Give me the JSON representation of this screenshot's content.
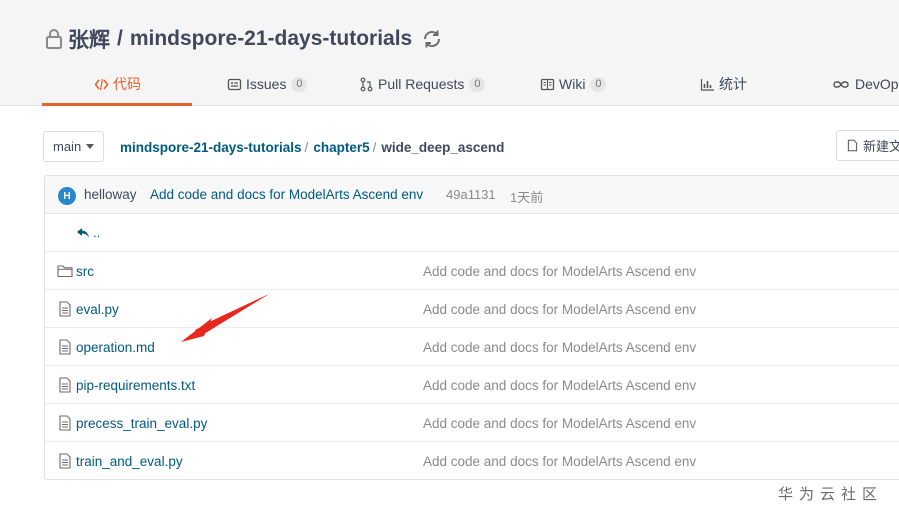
{
  "repo": {
    "owner": "张辉",
    "separator": "/",
    "name": "mindspore-21-days-tutorials"
  },
  "tabs": [
    {
      "label": "代码",
      "icon": "code-icon",
      "active": true
    },
    {
      "label": "Issues",
      "count": "0",
      "icon": "issues-icon"
    },
    {
      "label": "Pull Requests",
      "count": "0",
      "icon": "pull-request-icon"
    },
    {
      "label": "Wiki",
      "count": "0",
      "icon": "wiki-icon"
    },
    {
      "label": "统计",
      "icon": "stats-icon"
    },
    {
      "label": "DevOps",
      "icon": "devops-icon"
    }
  ],
  "branch": {
    "label": "main"
  },
  "breadcrumb": {
    "root": "mindspore-21-days-tutorials",
    "folder": "chapter5",
    "current": "wide_deep_ascend",
    "slash": "/"
  },
  "new_file_button": "新建文件",
  "last_commit": {
    "avatar_letter": "H",
    "author": "helloway",
    "message": "Add code and docs for ModelArts Ascend env",
    "sha": "49a1131",
    "time": "1天前"
  },
  "parent_dir": "..",
  "files": [
    {
      "name": "src",
      "type": "folder",
      "message": "Add code and docs for ModelArts Ascend env"
    },
    {
      "name": "eval.py",
      "type": "file",
      "message": "Add code and docs for ModelArts Ascend env"
    },
    {
      "name": "operation.md",
      "type": "file",
      "message": "Add code and docs for ModelArts Ascend env"
    },
    {
      "name": "pip-requirements.txt",
      "type": "file",
      "message": "Add code and docs for ModelArts Ascend env"
    },
    {
      "name": "precess_train_eval.py",
      "type": "file",
      "message": "Add code and docs for ModelArts Ascend env"
    },
    {
      "name": "train_and_eval.py",
      "type": "file",
      "message": "Add code and docs for ModelArts Ascend env"
    }
  ],
  "watermark": "华为云社区",
  "colors": {
    "accent": "#e8612a",
    "link": "#005980",
    "annotation_arrow": "#e8271f"
  }
}
